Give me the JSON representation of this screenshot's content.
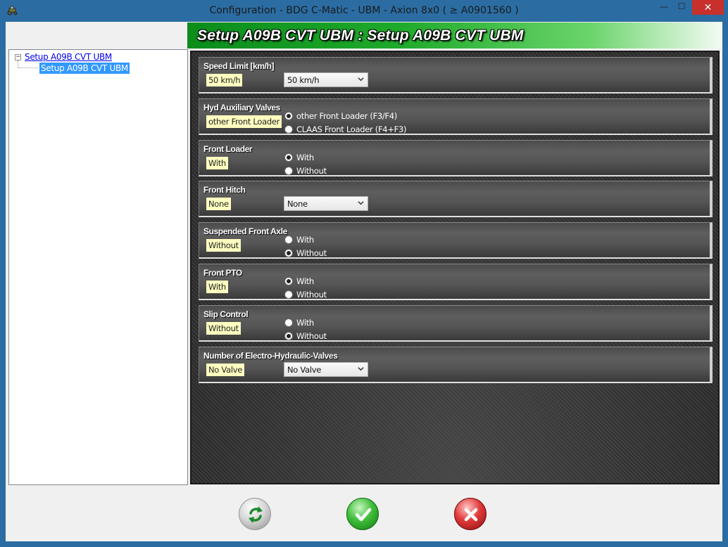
{
  "window": {
    "title": "Configuration - BDG C-Matic - UBM - Axion 8x0 ( ≥ A0901560 )",
    "min_glyph": "—",
    "max_glyph": "☐",
    "close_glyph": "✕"
  },
  "header": {
    "title": "Setup A09B CVT UBM : Setup A09B CVT UBM"
  },
  "tree": {
    "toggle_glyph": "−",
    "root_label": "Setup A09B CVT UBM",
    "child_label": "Setup A09B CVT UBM"
  },
  "settings": [
    {
      "title": "Speed Limit [km/h]",
      "value": "50 km/h",
      "control": "dropdown",
      "dropdown_value": "50 km/h"
    },
    {
      "title": "Hyd Auxiliary Valves",
      "value": "other Front Loader",
      "control": "radio",
      "options": [
        {
          "label": "other Front Loader (F3/F4)",
          "checked": true
        },
        {
          "label": "CLAAS Front Loader (F4+F3)",
          "checked": false
        }
      ]
    },
    {
      "title": "Front Loader",
      "value": "With",
      "control": "radio",
      "options": [
        {
          "label": "With",
          "checked": true
        },
        {
          "label": "Without",
          "checked": false
        }
      ]
    },
    {
      "title": "Front Hitch",
      "value": "None",
      "control": "dropdown",
      "dropdown_value": "None"
    },
    {
      "title": "Suspended Front Axle",
      "value": "Without",
      "control": "radio",
      "options": [
        {
          "label": "With",
          "checked": false
        },
        {
          "label": "Without",
          "checked": true
        }
      ]
    },
    {
      "title": "Front PTO",
      "value": "With",
      "control": "radio",
      "options": [
        {
          "label": "With",
          "checked": true
        },
        {
          "label": "Without",
          "checked": false
        }
      ]
    },
    {
      "title": "Slip Control",
      "value": "Without",
      "control": "radio",
      "options": [
        {
          "label": "With",
          "checked": false
        },
        {
          "label": "Without",
          "checked": true
        }
      ]
    },
    {
      "title": "Number of Electro-Hydraulic-Valves",
      "value": "No Valve",
      "control": "dropdown",
      "dropdown_value": "No Valve"
    }
  ],
  "footer": {
    "refresh_icon": "refresh-icon",
    "ok_icon": "checkmark-icon",
    "cancel_icon": "x-icon"
  },
  "colors": {
    "title_bar": "#2b6da3",
    "close_button": "#c7302b",
    "header_green": "#1faa2b",
    "value_highlight": "#ffffc0",
    "tree_selection": "#3399ff"
  }
}
